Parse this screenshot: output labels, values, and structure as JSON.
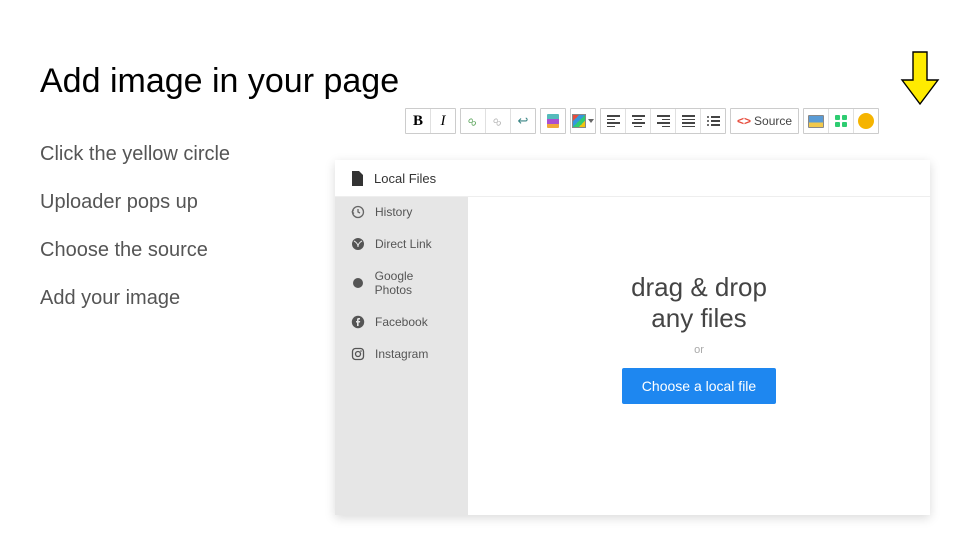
{
  "title": "Add image in your page",
  "steps": [
    "Click the yellow circle",
    "Uploader pops up",
    "Choose the source",
    "Add your image"
  ],
  "toolbar": {
    "bold": "B",
    "italic": "I",
    "source": "Source"
  },
  "uploader": {
    "header": "Local Files",
    "sources": [
      "History",
      "Direct Link",
      "Google Photos",
      "Facebook",
      "Instagram"
    ],
    "drop_line1": "drag & drop",
    "drop_line2": "any files",
    "or": "or",
    "choose": "Choose a local file"
  }
}
